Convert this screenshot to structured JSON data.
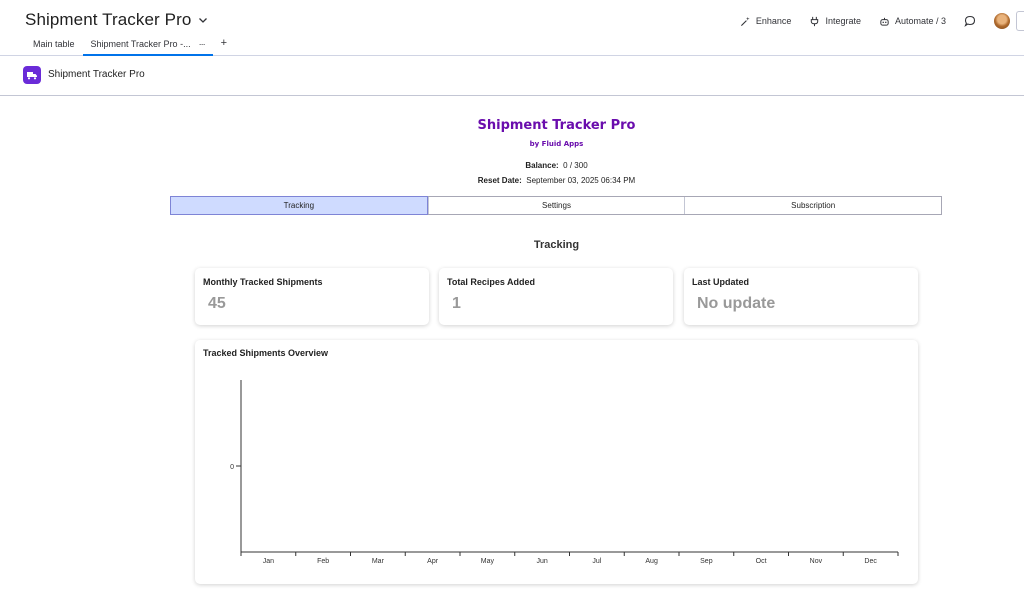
{
  "header": {
    "board_title": "Shipment Tracker Pro",
    "tabs": [
      {
        "label": "Main table"
      },
      {
        "label": "Shipment Tracker Pro -...",
        "more": "···"
      }
    ],
    "add_tab": "+",
    "actions": {
      "enhance": "Enhance",
      "integrate": "Integrate",
      "automate": "Automate / 3"
    }
  },
  "app_bar": {
    "name": "Shipment Tracker Pro"
  },
  "app": {
    "title": "Shipment Tracker Pro",
    "by_line": "by Fluid Apps",
    "balance_label": "Balance:",
    "balance_value": "0 / 300",
    "reset_label": "Reset Date:",
    "reset_value": "September 03, 2025 06:34 PM",
    "nav_tabs": [
      {
        "label": "Tracking",
        "active": true
      },
      {
        "label": "Settings",
        "active": false
      },
      {
        "label": "Subscription",
        "active": false
      }
    ],
    "section_title": "Tracking",
    "cards": [
      {
        "label": "Monthly Tracked Shipments",
        "value": "45"
      },
      {
        "label": "Total Recipes Added",
        "value": "1"
      },
      {
        "label": "Last Updated",
        "value": "No update"
      }
    ]
  },
  "chart_data": {
    "type": "line",
    "title": "Tracked Shipments Overview",
    "categories": [
      "Jan",
      "Feb",
      "Mar",
      "Apr",
      "May",
      "Jun",
      "Jul",
      "Aug",
      "Sep",
      "Oct",
      "Nov",
      "Dec"
    ],
    "y_ticks": [
      "0"
    ],
    "series": [],
    "xlabel": "",
    "ylabel": "",
    "grid": false,
    "legend": "none"
  },
  "colors": {
    "accent_purple": "#6a0dad",
    "active_tab_bg": "#cfdbff",
    "tab_underline": "#0073ea",
    "card_value": "#999999"
  }
}
